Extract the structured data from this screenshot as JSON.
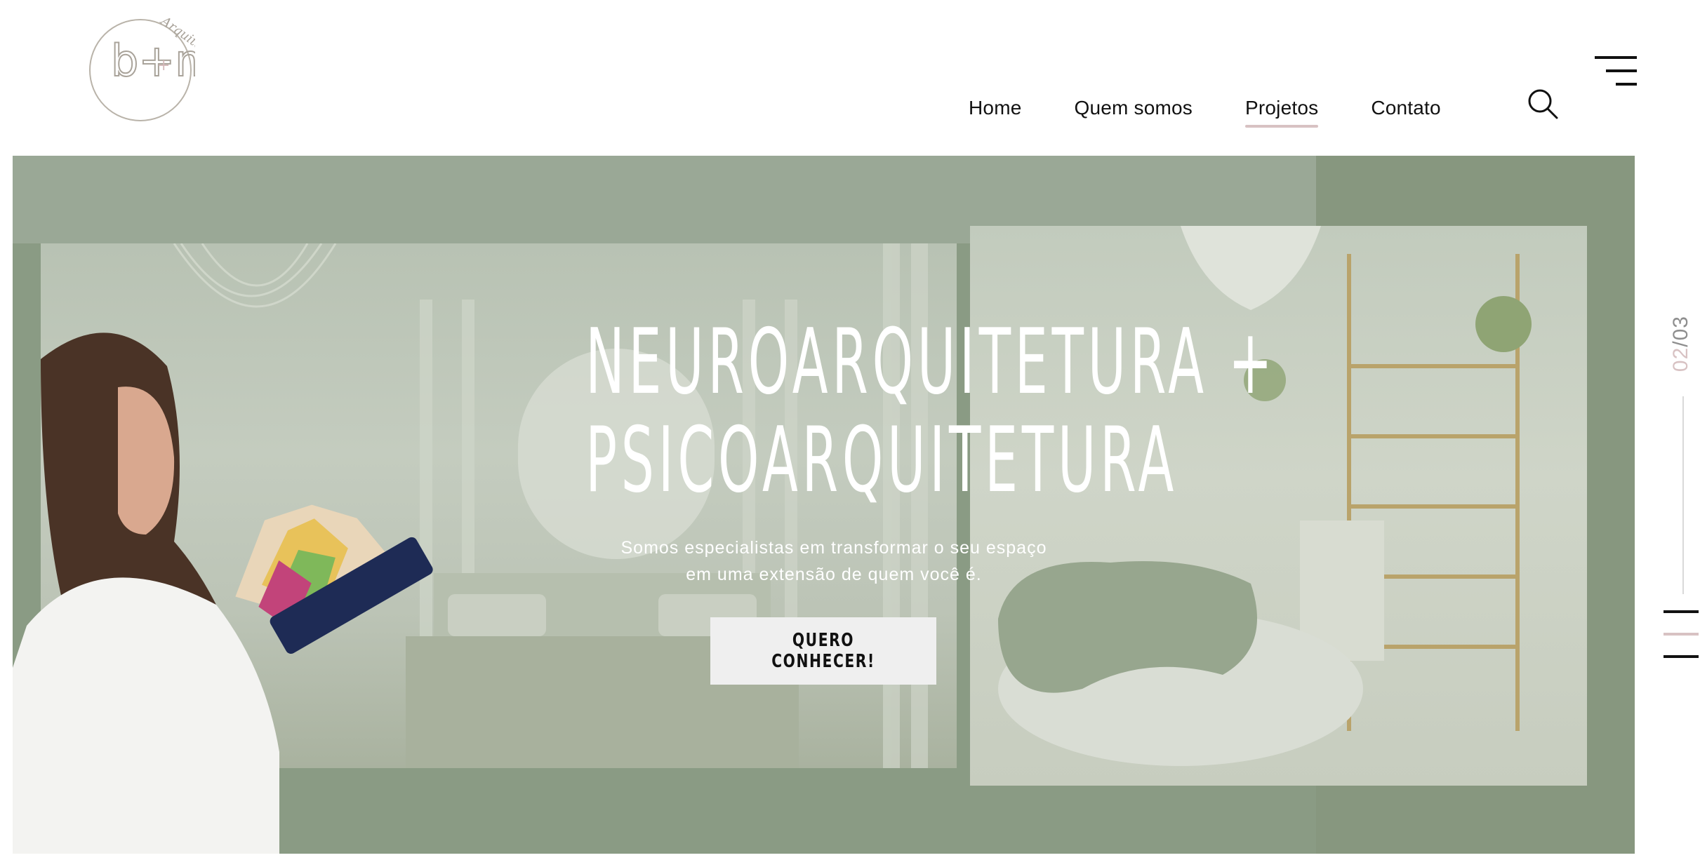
{
  "header": {
    "logo": {
      "mark": "b+m",
      "script_text": "Arquitetas"
    },
    "nav": [
      {
        "label": "Home",
        "active": false
      },
      {
        "label": "Quem somos",
        "active": false
      },
      {
        "label": "Projetos",
        "active": true
      },
      {
        "label": "Contato",
        "active": false
      }
    ],
    "search_icon": "search-icon",
    "menu_icon": "hamburger-menu-icon"
  },
  "hero": {
    "title_line1": "NEUROARQUITETURA +",
    "title_line2": "PSICOARQUITETURA",
    "subtitle_line1": "Somos especialistas em transformar o seu espaço",
    "subtitle_line2": "em uma extensão de quem você é.",
    "cta_label": "QUERO CONHECER!"
  },
  "slider": {
    "current": "02",
    "separator": "/",
    "total": "03",
    "active_index": 1
  },
  "colors": {
    "accent": "#d8c2c3",
    "hero_green": "#8a9b84",
    "text": "#111111"
  }
}
